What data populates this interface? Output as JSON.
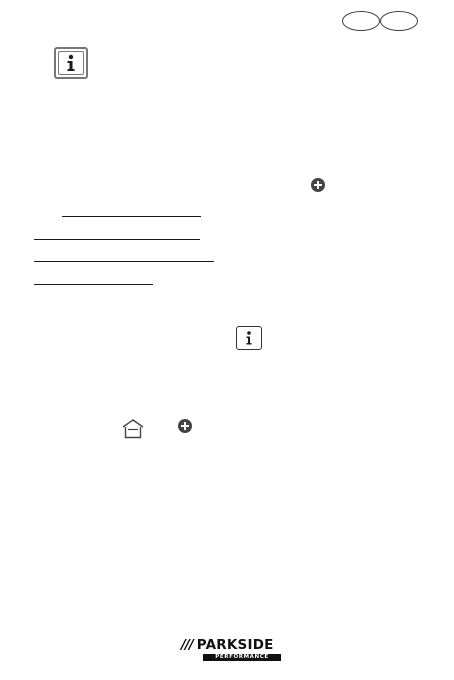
{
  "header": {
    "language_badges": [
      "",
      ""
    ]
  },
  "icons": {
    "info_large": "info-icon",
    "info_small": "info-icon",
    "plus_top": "plus-circle-icon",
    "home": "home-icon",
    "plus_bottom": "plus-circle-icon"
  },
  "footer": {
    "brand": {
      "slashes": "///",
      "name": "PARKSIDE",
      "subline": "PERFORMANCE"
    }
  }
}
